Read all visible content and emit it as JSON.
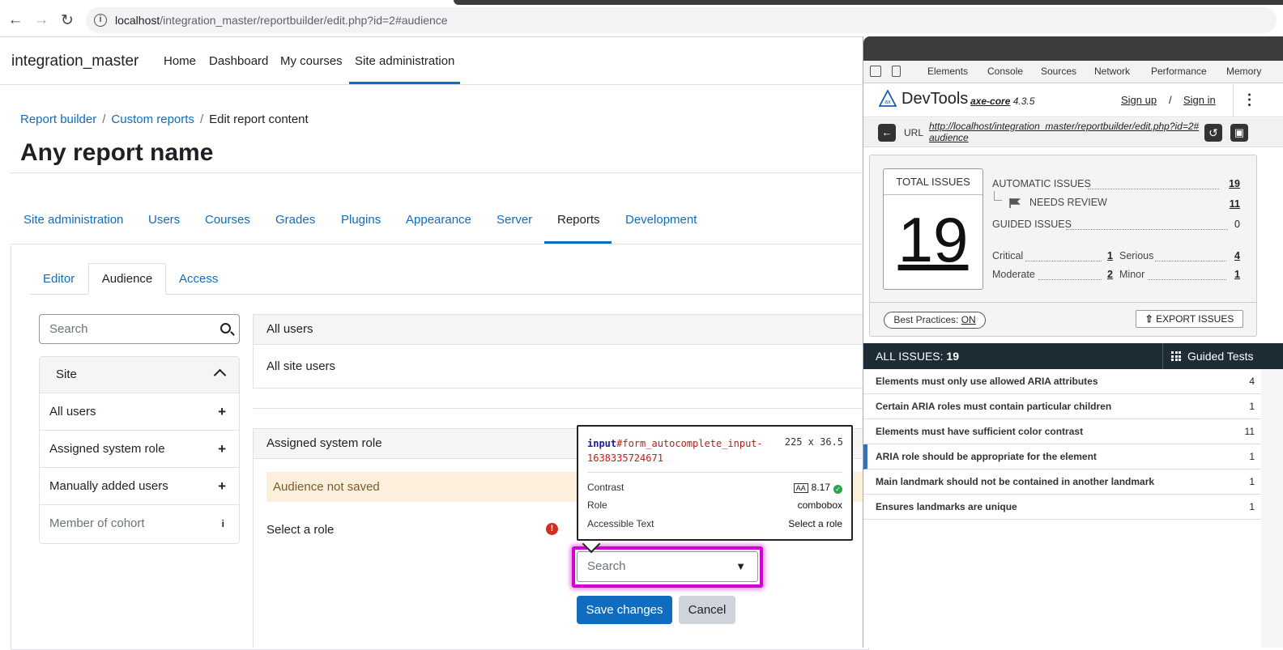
{
  "browser": {
    "url_host": "localhost",
    "url_path": "/integration_master/reportbuilder/edit.php?id=2#audience"
  },
  "site": {
    "brand": "integration_master",
    "nav": [
      "Home",
      "Dashboard",
      "My courses",
      "Site administration"
    ]
  },
  "breadcrumb": [
    "Report builder",
    "Custom reports",
    "Edit report content"
  ],
  "page_title": "Any report name",
  "section_tabs": [
    "Site administration",
    "Users",
    "Courses",
    "Grades",
    "Plugins",
    "Appearance",
    "Server",
    "Reports",
    "Development"
  ],
  "sub_tabs": [
    "Editor",
    "Audience",
    "Access"
  ],
  "sidebar": {
    "search_placeholder": "Search",
    "section_title": "Site",
    "items": [
      "All users",
      "Assigned system role",
      "Manually added users",
      "Member of cohort"
    ]
  },
  "audience": {
    "block1_title": "All users",
    "block1_body": "All site users",
    "block2_title": "Assigned system role",
    "warning": "Audience not saved",
    "role_label": "Select a role",
    "combo_placeholder": "Search",
    "save": "Save changes",
    "cancel": "Cancel"
  },
  "tooltip": {
    "tag": "input",
    "selector": "#form_autocomplete_input-1638335724671",
    "dims": "225 x 36.5",
    "contrast_label": "Contrast",
    "contrast_badge": "AA",
    "contrast_value": "8.17",
    "role_label": "Role",
    "role_value": "combobox",
    "acc_label": "Accessible Text",
    "acc_value": "Select a role"
  },
  "devtools": {
    "tabs": [
      "Elements",
      "Console",
      "Sources",
      "Network",
      "Performance",
      "Memory"
    ],
    "title": "DevTools",
    "core": "axe-core",
    "version": "4.3.5",
    "signup": "Sign up",
    "slash": "/",
    "signin": "Sign in",
    "url_label": "URL",
    "url_value": "http://localhost/integration_master/reportbuilder/edit.php?id=2#audience",
    "total_label": "TOTAL ISSUES",
    "total": "19",
    "automatic_label": "AUTOMATIC ISSUES",
    "automatic": "19",
    "review_label": "NEEDS REVIEW",
    "review": "11",
    "guided_label": "GUIDED ISSUES",
    "guided": "0",
    "critical_label": "Critical",
    "critical": "1",
    "serious_label": "Serious",
    "serious": "4",
    "moderate_label": "Moderate",
    "moderate": "2",
    "minor_label": "Minor",
    "minor": "1",
    "best_practices": "Best Practices:",
    "best_state": "ON",
    "export": "EXPORT ISSUES",
    "all_issues_label": "ALL ISSUES:",
    "all_issues": "19",
    "guided_tests": "Guided Tests",
    "issues": [
      {
        "text": "Elements must only use allowed ARIA attributes",
        "count": "4"
      },
      {
        "text": "Certain ARIA roles must contain particular children",
        "count": "1"
      },
      {
        "text": "Elements must have sufficient color contrast",
        "count": "11"
      },
      {
        "text": "ARIA role should be appropriate for the element",
        "count": "1"
      },
      {
        "text": "Main landmark should not be contained in another landmark",
        "count": "1"
      },
      {
        "text": "Ensures landmarks are unique",
        "count": "1"
      }
    ]
  },
  "colors": {
    "link": "#0f6cbf",
    "highlight": "#d100d1",
    "devtools_bar": "#1e2c36",
    "warning_bg": "#fcefdc"
  }
}
